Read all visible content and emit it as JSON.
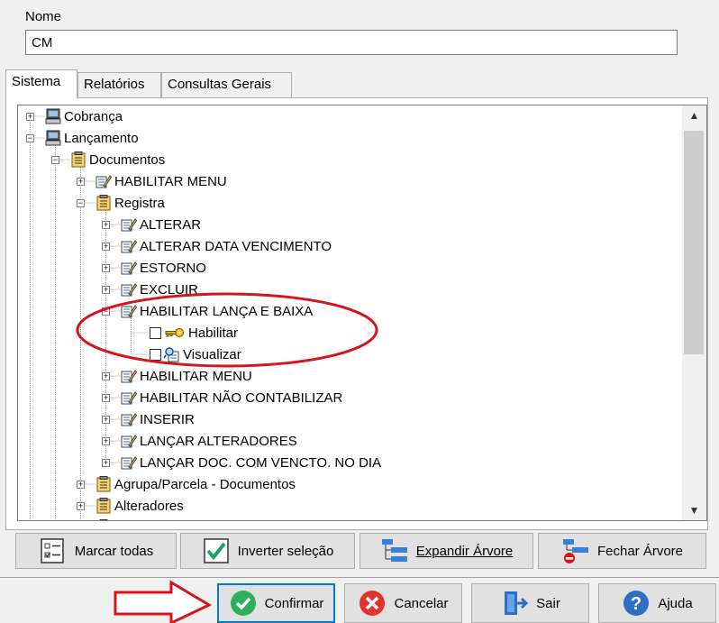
{
  "name_field": {
    "label": "Nome",
    "value": "CM"
  },
  "tabs": [
    {
      "label": "Sistema",
      "active": true
    },
    {
      "label": "Relatórios",
      "active": false
    },
    {
      "label": "Consultas Gerais",
      "active": false
    }
  ],
  "tree": {
    "cobranca": "Cobrança",
    "lancamento": "Lançamento",
    "documentos": "Documentos",
    "habilitar_menu_1": "HABILITAR MENU",
    "registra": "Registra",
    "alterar": "ALTERAR",
    "alterar_data_vencimento": "ALTERAR DATA VENCIMENTO",
    "estorno": "ESTORNO",
    "excluir": "EXCLUIR",
    "habilitar_lanca_baixa": "HABILITAR LANÇA E BAIXA",
    "habilitar": "Habilitar",
    "visualizar": "Visualizar",
    "habilitar_menu_2": "HABILITAR MENU",
    "habilitar_nao_contabilizar": "HABILITAR NÃO CONTABILIZAR",
    "inserir": "INSERIR",
    "lancar_alteradores": "LANÇAR ALTERADORES",
    "lancar_doc_vencto": "LANÇAR DOC. COM VENCTO. NO DIA",
    "agrupa_parcela": "Agrupa/Parcela - Documentos",
    "alteradores": "Alteradores"
  },
  "tree_buttons": {
    "marcar_todas": "Marcar todas",
    "inverter_selecao": "Inverter seleção",
    "expandir_arvore": "Expandir Árvore",
    "fechar_arvore": "Fechar Árvore"
  },
  "dialog_buttons": {
    "confirmar": "Confirmar",
    "cancelar": "Cancelar",
    "sair": "Sair",
    "ajuda": "Ajuda"
  },
  "annotation_color": "#d8141b"
}
